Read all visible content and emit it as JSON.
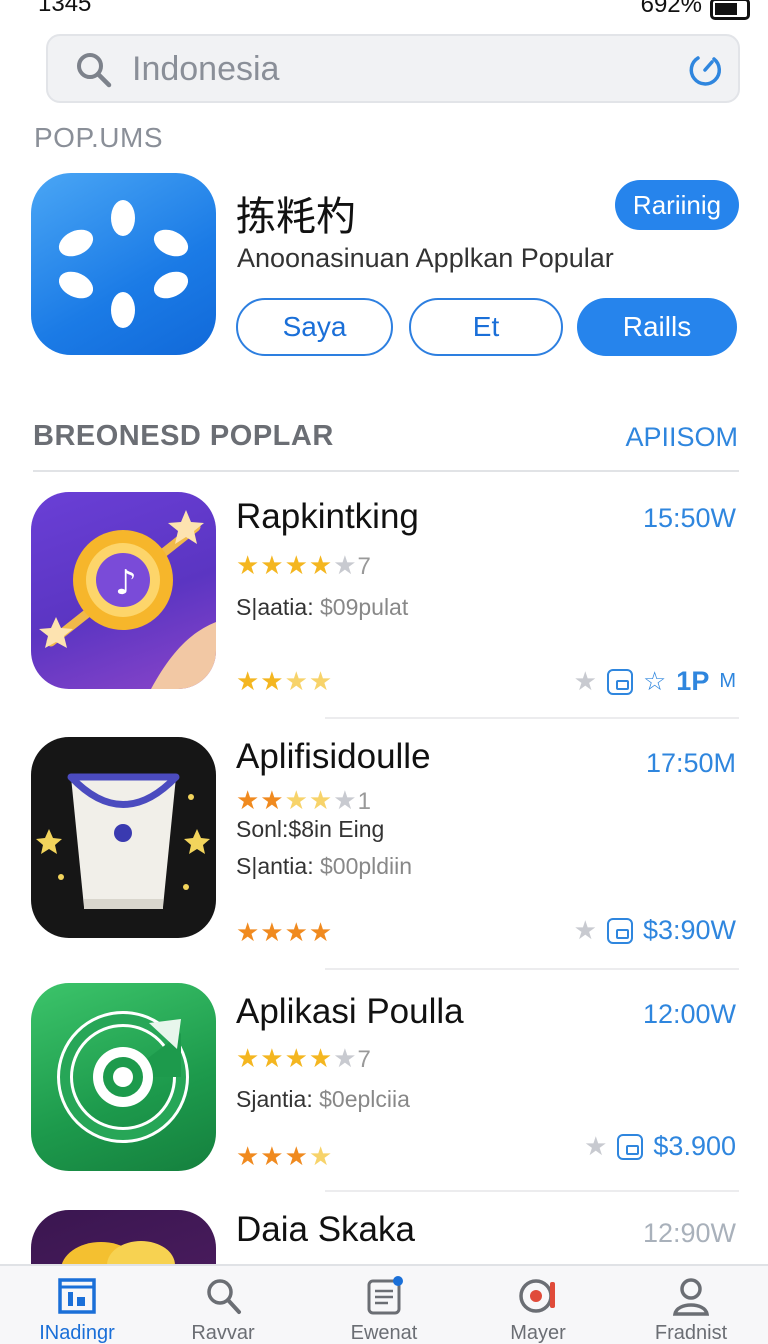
{
  "status_bar": {
    "time": "1345",
    "signal_battery": "692%"
  },
  "search": {
    "value": "Indonesia"
  },
  "section_popular": {
    "label": "POP.UMS"
  },
  "featured": {
    "title": "拣粍杓",
    "subtitle": "Anoonasinuan Applkan Popular",
    "ranking_button": "Rariinig",
    "buttons": [
      "Saya",
      "Et",
      "Raills"
    ]
  },
  "section_recommended": {
    "title": "BREONESD POPLAR",
    "link": "APIISOM"
  },
  "apps": [
    {
      "name": "Rapkintking",
      "time": "15:50W",
      "rating_suffix": "7",
      "meta1_label": "S|aatia:",
      "meta1_value": "$09pulat",
      "action_label": "1P",
      "action_suffix": "M"
    },
    {
      "name": "Aplifisidoulle",
      "time": "17:50M",
      "rating_suffix": "1",
      "meta0": "Sonl:$8in Eing",
      "meta1_label": "S|antia:",
      "meta1_value": "$00pldiin",
      "action_label": "$3:90W"
    },
    {
      "name": "Aplikasi Poulla",
      "time": "12:00W",
      "rating_suffix": "7",
      "meta1_label": "Sjantia:",
      "meta1_value": "$0eplciia",
      "action_label": "$3.900"
    },
    {
      "name": "Daia Skaka",
      "time": "12:90W"
    }
  ],
  "tabs": [
    {
      "label": "INadingr",
      "icon": "home-icon",
      "active": true
    },
    {
      "label": "Ravvar",
      "icon": "search-icon"
    },
    {
      "label": "Ewenat",
      "icon": "document-icon"
    },
    {
      "label": "Mayer",
      "icon": "media-icon"
    },
    {
      "label": "Fradnist",
      "icon": "person-icon"
    }
  ],
  "colors": {
    "accent": "#2684ec",
    "link": "#2f86de",
    "star": "#f4b620",
    "star_orange": "#f08a1f"
  }
}
